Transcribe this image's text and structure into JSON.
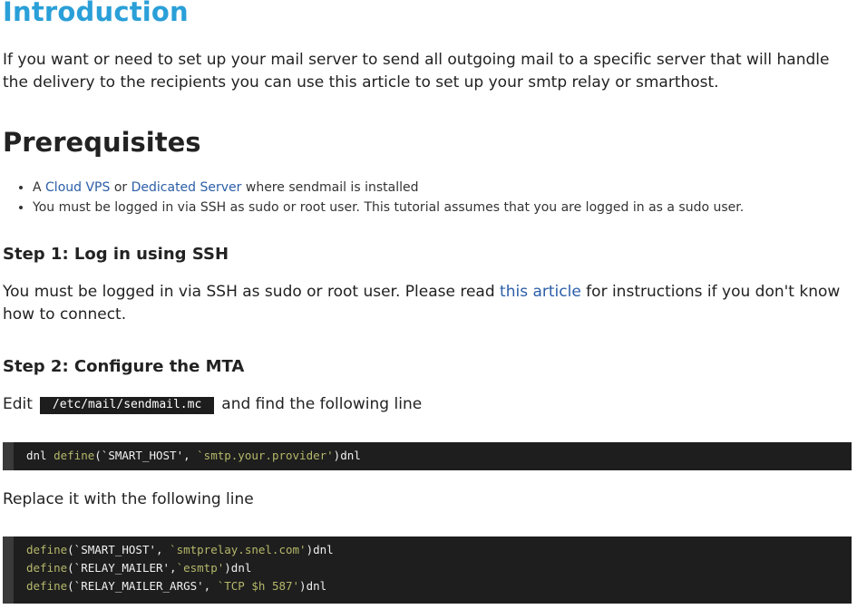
{
  "intro": {
    "title": "Introduction",
    "paragraph": "If you want or need to set up your mail server to send all outgoing mail to a specific server that will handle the delivery to the recipients you can use this article to set up your smtp relay or smarthost."
  },
  "prerequisites": {
    "title": "Prerequisites",
    "item1": {
      "prefix": "A ",
      "link1": "Cloud VPS",
      "middle": " or ",
      "link2": "Dedicated Server",
      "suffix": " where sendmail is installed"
    },
    "item2": "You must be logged in via SSH as sudo or root user. This tutorial assumes that you are logged in as a sudo user."
  },
  "step1": {
    "title": "Step 1: Log in using SSH",
    "text_before": "You must be logged in via SSH as sudo or root user. Please read ",
    "link": "this article",
    "text_after": " for instructions if you don't know how to connect."
  },
  "step2": {
    "title": "Step 2: Configure the MTA",
    "edit_prefix": "Edit",
    "file_path": "/etc/mail/sendmail.mc",
    "edit_suffix": "and find the following line",
    "code1": {
      "a": "dnl ",
      "b": "define",
      "c": "(`SMART_HOST', ",
      "d": "`smtp.your.provider'",
      "e": ")dnl"
    },
    "replace_text": "Replace it with the following line",
    "code2": [
      {
        "a": "define",
        "b": "(`SMART_HOST', ",
        "c": "`smtprelay.snel.com'",
        "d": ")dnl"
      },
      {
        "a": "define",
        "b": "(`RELAY_MAILER',",
        "c": "`esmtp'",
        "d": ")dnl"
      },
      {
        "a": "define",
        "b": "(`RELAY_MAILER_ARGS', ",
        "c": "`TCP $h 587'",
        "d": ")dnl"
      }
    ]
  },
  "colors": {
    "title_blue": "#2a9fd8",
    "link_blue": "#2b5ea8",
    "code_bg": "#1e1e1e",
    "code_string": "#b5b86a"
  }
}
